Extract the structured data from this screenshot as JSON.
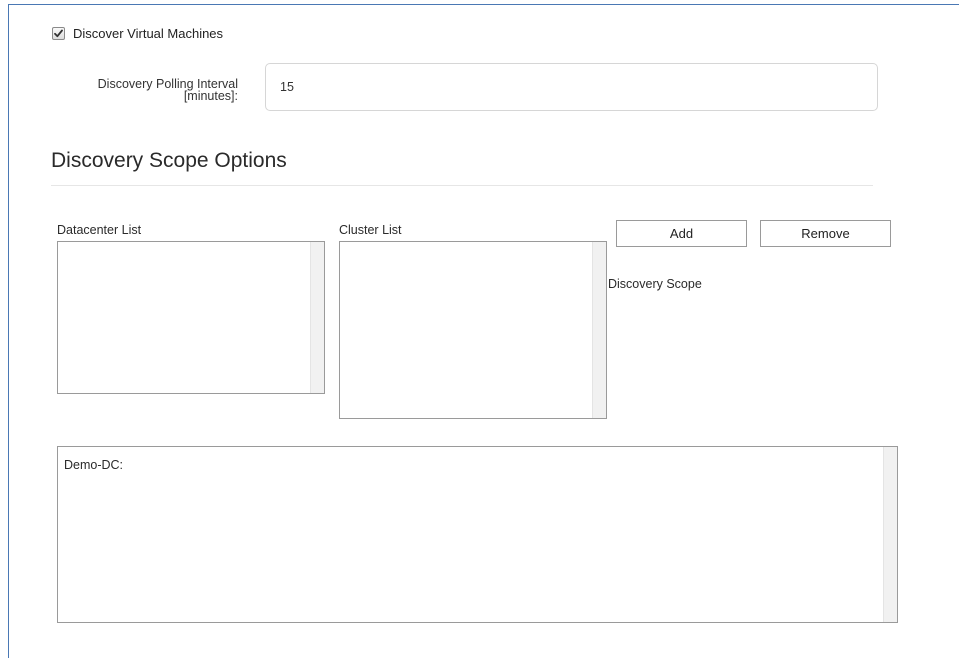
{
  "discover_vms": {
    "label": "Discover Virtual Machines",
    "checked": true
  },
  "polling": {
    "label_line1": "Discovery Polling Interval",
    "label_line2": "[minutes]:",
    "value": "15"
  },
  "section": {
    "title": "Discovery Scope Options"
  },
  "datacenter_list": {
    "label": "Datacenter List",
    "items": []
  },
  "cluster_list": {
    "label": "Cluster List",
    "items": []
  },
  "buttons": {
    "add_label": "Add",
    "remove_label": "Remove"
  },
  "discovery_scope": {
    "label": "Discovery Scope",
    "items": [
      "Demo-DC:"
    ]
  },
  "colors": {
    "frame_border": "#4a78b4",
    "list_border": "#9a9a9a"
  }
}
